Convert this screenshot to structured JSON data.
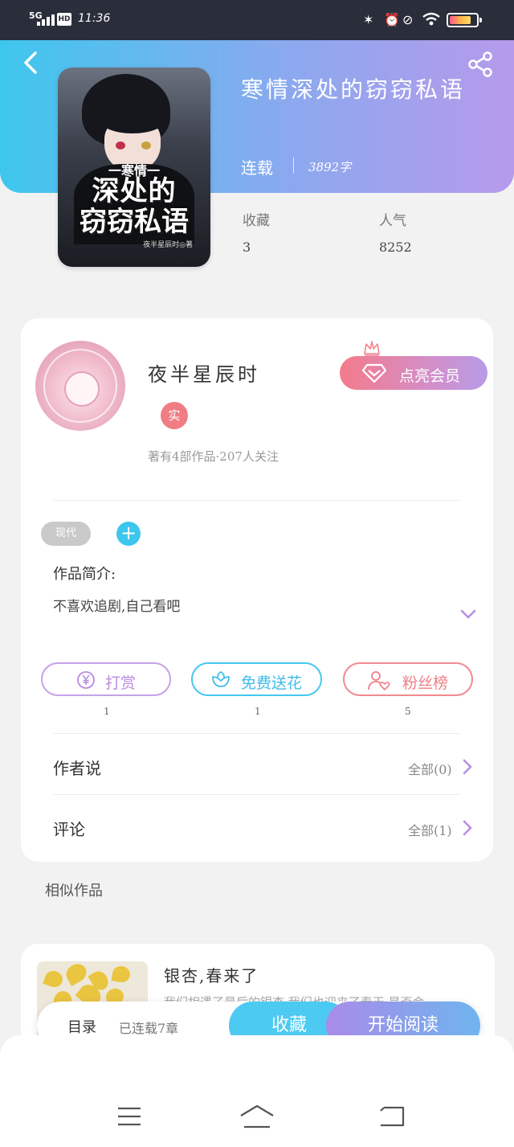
{
  "status_bar": {
    "network": "5G",
    "hd_badge": "HD",
    "time": "11:36"
  },
  "book": {
    "title": "寒情深处的窃窃私语",
    "status": "连载",
    "word_count": "3892字",
    "cover": {
      "subtitle": "一寒情一",
      "line1": "深处的",
      "line2": "窃窃私语",
      "byline": "夜半星辰时◎著"
    },
    "stats": [
      {
        "label": "收藏",
        "value": "3"
      },
      {
        "label": "人气",
        "value": "8252"
      }
    ]
  },
  "author": {
    "name": "夜半星辰时",
    "badge": "实",
    "summary": "著有4部作品·207人关注",
    "vip_button": "点亮会员"
  },
  "tags": {
    "genre": "现代",
    "add": "+"
  },
  "intro": {
    "label": "作品简介:",
    "text": "不喜欢追剧,自己看吧"
  },
  "actions": [
    {
      "label": "打赏",
      "count": "1",
      "icon": "yen-icon"
    },
    {
      "label": "免费送花",
      "count": "1",
      "icon": "flower-icon"
    },
    {
      "label": "粉丝榜",
      "count": "5",
      "icon": "fan-rank-icon"
    }
  ],
  "rows": {
    "author_says": {
      "label": "作者说",
      "all": "全部(0)"
    },
    "comments": {
      "label": "评论",
      "all": "全部(1)"
    }
  },
  "similar": {
    "label": "相似作品",
    "items": [
      {
        "title": "银杏,春来了",
        "desc": "我们相遇了最后的银杏,我们也迎来了春天,是否会..."
      }
    ]
  },
  "bottom_bar": {
    "catalog": "目录",
    "chapters": "已连载7章",
    "favorite": "收藏",
    "start_reading": "开始阅读"
  },
  "colors": {
    "header_start": "#3ec7ee",
    "header_end": "#b79aeb",
    "accent_blue": "#4dcaf2",
    "accent_purple": "#b98ae0",
    "accent_red": "#ef7f86"
  }
}
